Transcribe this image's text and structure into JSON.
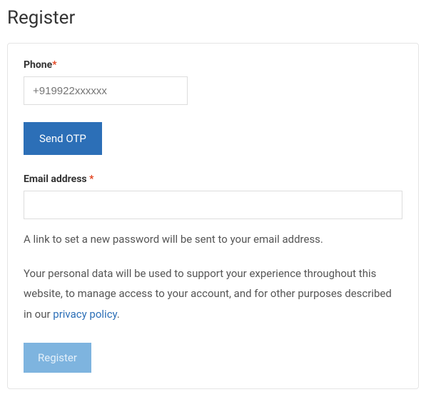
{
  "title": "Register",
  "phone": {
    "label": "Phone",
    "required": "*",
    "placeholder": "+919922xxxxxx"
  },
  "sendOtp": {
    "label": "Send OTP"
  },
  "email": {
    "label": "Email address ",
    "required": "*"
  },
  "helper": "A link to set a new password will be sent to your email address.",
  "privacy": {
    "preText": "Your personal data will be used to support your experience throughout this website, to manage access to your account, and for other purposes described in our ",
    "linkText": "privacy policy",
    "postText": "."
  },
  "registerButton": {
    "label": "Register"
  }
}
